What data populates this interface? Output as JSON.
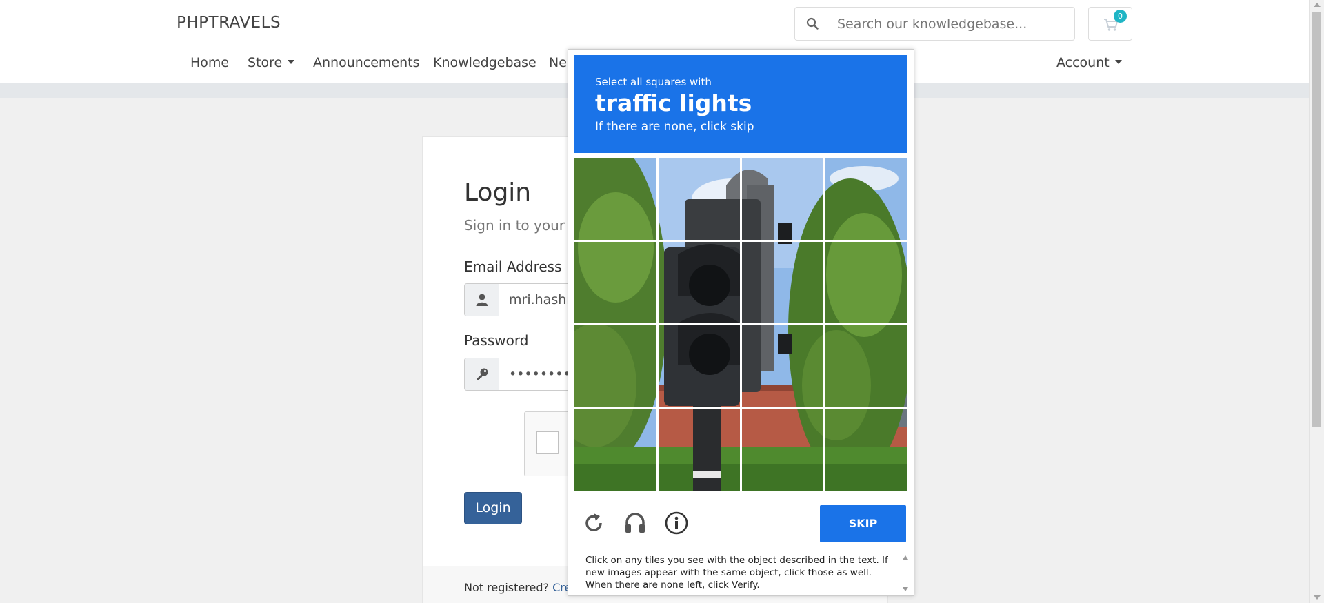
{
  "header": {
    "brand": "PHPTRAVELS",
    "search_placeholder": "Search our knowledgebase...",
    "cart_count": "0",
    "nav": [
      "Home",
      "Store",
      "Announcements",
      "Knowledgebase",
      "Ne"
    ],
    "account_label": "Account"
  },
  "login": {
    "title": "Login",
    "subtitle": "Sign in to your a",
    "email_label": "Email Address",
    "email_value": "mri.hashr",
    "password_label": "Password",
    "password_value": "••••••••••••",
    "button_label": "Login",
    "not_registered": "Not registered?",
    "create_link": "Crea"
  },
  "captcha": {
    "line1": "Select all squares with",
    "target": "traffic lights",
    "line3": "If there are none, click skip",
    "skip_label": "SKIP",
    "help_text": "Click on any tiles you see with the object described in the text. If new images appear with the same object, click those as well. When there are none left, click Verify.",
    "tools": [
      "reload-icon",
      "audio-icon",
      "info-icon"
    ],
    "accent_color": "#1a73e8"
  },
  "colors": {
    "primary_button": "#356299",
    "badge": "#1fb5c5"
  }
}
